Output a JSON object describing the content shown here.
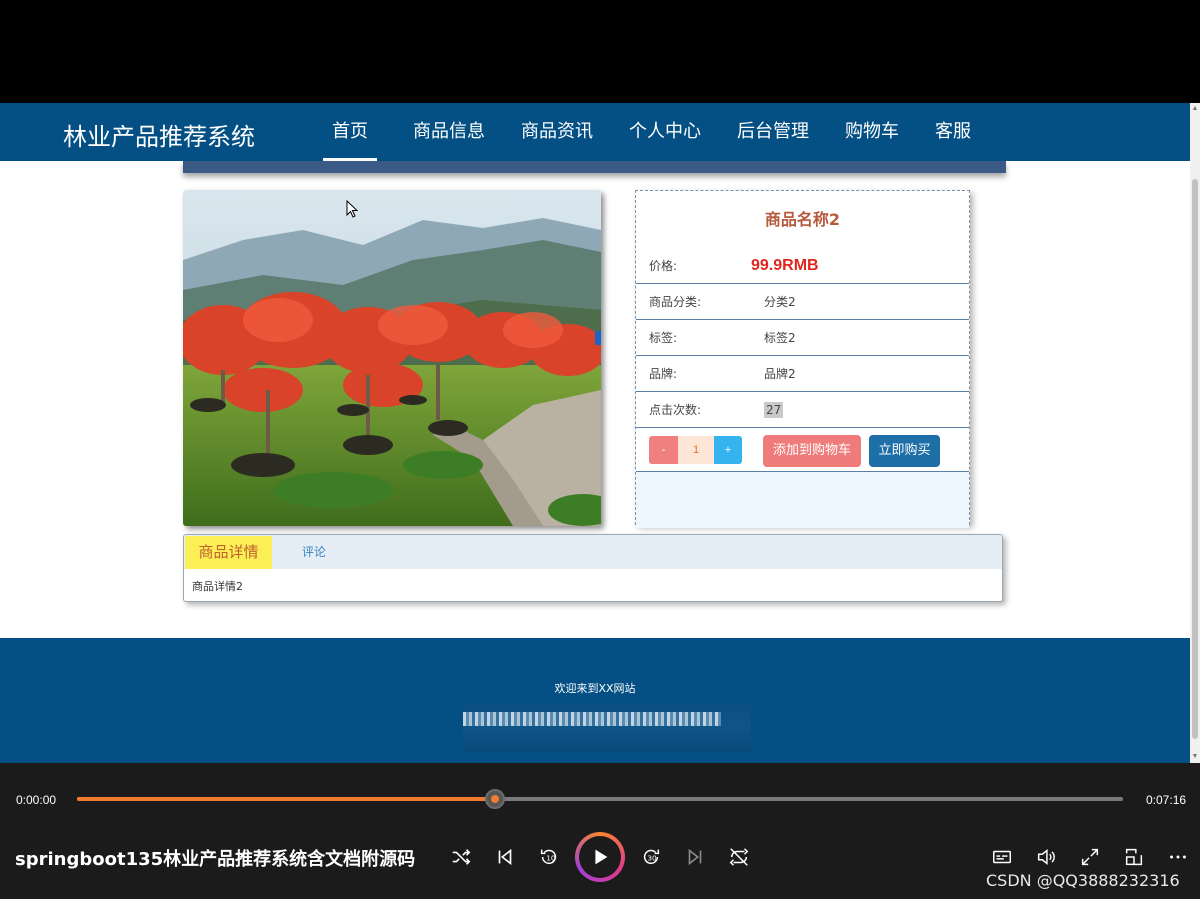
{
  "site": {
    "brand": "林业产品推荐系统",
    "nav": [
      "首页",
      "商品信息",
      "商品资讯",
      "个人中心",
      "后台管理",
      "购物车",
      "客服"
    ],
    "active_nav": "首页"
  },
  "product": {
    "name": "商品名称2",
    "price_label": "价格:",
    "price_value": "99.9RMB",
    "category_label": "商品分类:",
    "category_value": "分类2",
    "tag_label": "标签:",
    "tag_value": "标签2",
    "brand_label": "品牌:",
    "brand_value": "品牌2",
    "clicks_label": "点击次数:",
    "clicks_value": "27",
    "qty_minus": "-",
    "qty_value": "1",
    "qty_plus": "+",
    "add_to_cart": "添加到购物车",
    "buy_now": "立即购买",
    "price_color": "#e1261f"
  },
  "tabs": {
    "detail_tab": "商品详情",
    "comment_tab": "评论",
    "detail_content": "商品详情2"
  },
  "footer": {
    "welcome": "欢迎来到XX网站"
  },
  "player": {
    "time_current": "0:00:00",
    "time_total": "0:07:16",
    "progress": 0.4,
    "title": "springboot135林业产品推荐系统含文档附源码",
    "watermark": "CSDN @QQ3888232316",
    "accent": "#f07b33"
  },
  "colors": {
    "navbar": "#045085",
    "footer": "#045085"
  }
}
